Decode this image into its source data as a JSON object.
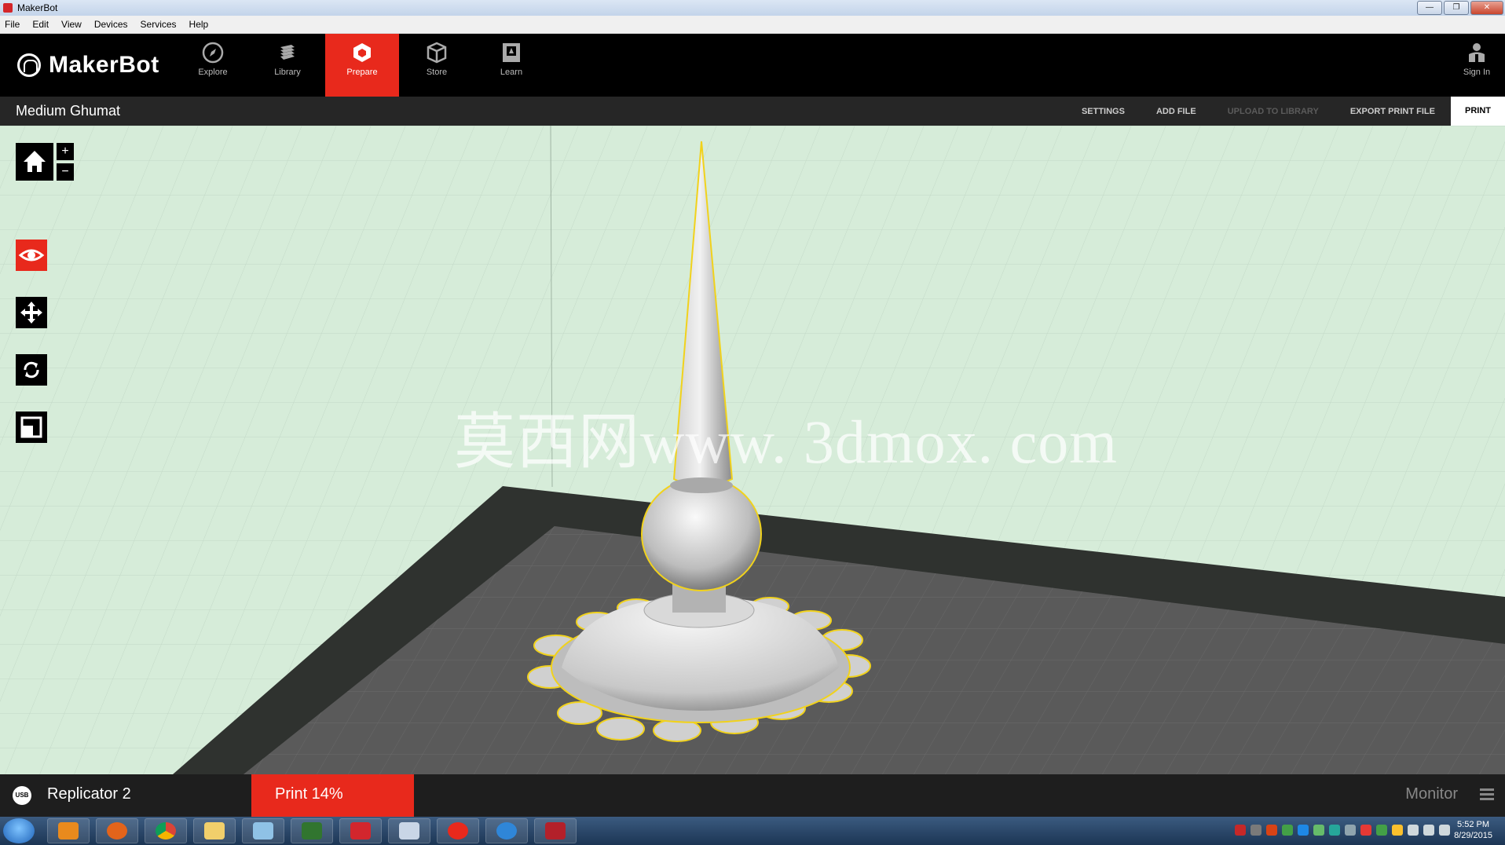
{
  "window": {
    "title": "MakerBot",
    "minimize": "—",
    "maximize": "❐",
    "close": "✕"
  },
  "menu": [
    "File",
    "Edit",
    "View",
    "Devices",
    "Services",
    "Help"
  ],
  "brand": "MakerBot",
  "nav": [
    {
      "label": "Explore",
      "icon": "compass-icon"
    },
    {
      "label": "Library",
      "icon": "library-icon"
    },
    {
      "label": "Prepare",
      "icon": "prepare-icon",
      "active": true
    },
    {
      "label": "Store",
      "icon": "box-icon"
    },
    {
      "label": "Learn",
      "icon": "book-icon"
    }
  ],
  "sign_in": "Sign In",
  "project": {
    "name": "Medium Ghumat"
  },
  "actions": {
    "settings": "SETTINGS",
    "add_file": "ADD FILE",
    "upload": "UPLOAD TO LIBRARY",
    "export": "EXPORT PRINT FILE",
    "print": "PRINT"
  },
  "viewport": {
    "watermark": "莫西网www. 3dmox. com",
    "zoom_in": "+",
    "zoom_out": "−",
    "tools": [
      "home-icon",
      "eye-icon",
      "move-icon",
      "rotate-icon",
      "scale-icon"
    ]
  },
  "status": {
    "usb": "USB",
    "device": "Replicator 2",
    "print_label": "Print 14%",
    "progress": 0.14,
    "monitor": "Monitor"
  },
  "taskbar": {
    "apps": [
      "media-player-icon",
      "firefox-icon",
      "chrome-icon",
      "file-explorer-icon",
      "notepad-icon",
      "project-icon",
      "solidworks-icon",
      "calculator-icon",
      "makerbot-icon",
      "ie-icon",
      "autocad-icon"
    ],
    "time": "5:52 PM",
    "date": "8/29/2015"
  },
  "colors": {
    "accent": "#e8291c",
    "grid": "#d6ecd9",
    "plate": "#5a5a5a",
    "selection": "#f1d21c"
  }
}
